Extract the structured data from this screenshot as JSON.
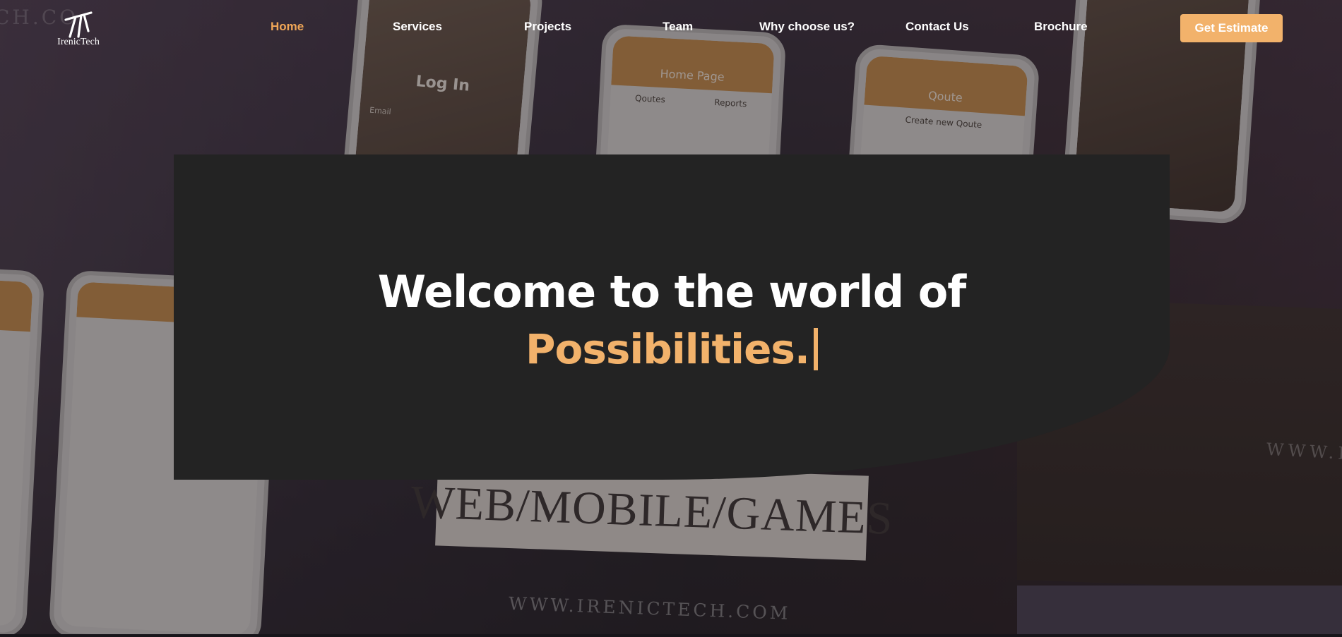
{
  "brand": {
    "logo_text": "IrenicTech"
  },
  "nav": {
    "items": [
      {
        "label": "Home",
        "active": true
      },
      {
        "label": "Services",
        "active": false
      },
      {
        "label": "Projects",
        "active": false
      },
      {
        "label": "Team",
        "active": false
      },
      {
        "label": "Why choose us?",
        "active": false
      },
      {
        "label": "Contact Us",
        "active": false
      },
      {
        "label": "Brochure",
        "active": false
      }
    ],
    "cta_label": "Get Estimate"
  },
  "hero": {
    "headline": "Welcome to the world of",
    "highlight": "Possibilities.",
    "background": {
      "phone_login_title": "Log In",
      "phone_email_label": "Email",
      "phone_home_title": "Home Page",
      "phone_tab_quotes": "Qoutes",
      "phone_tab_reports": "Reports",
      "phone_quote_title": "Qoute",
      "phone_create_quote": "Create new Qoute",
      "sign_text": "WEB/MOBILE/GAMES",
      "url_text": "WWW.IRENICTECH.COM",
      "corner_text": "CH.CO",
      "right_text": "WWW.I"
    }
  },
  "colors": {
    "accent": "#f2b26b",
    "active_nav": "#f0a657",
    "card": "#232323",
    "text": "#ffffff"
  }
}
